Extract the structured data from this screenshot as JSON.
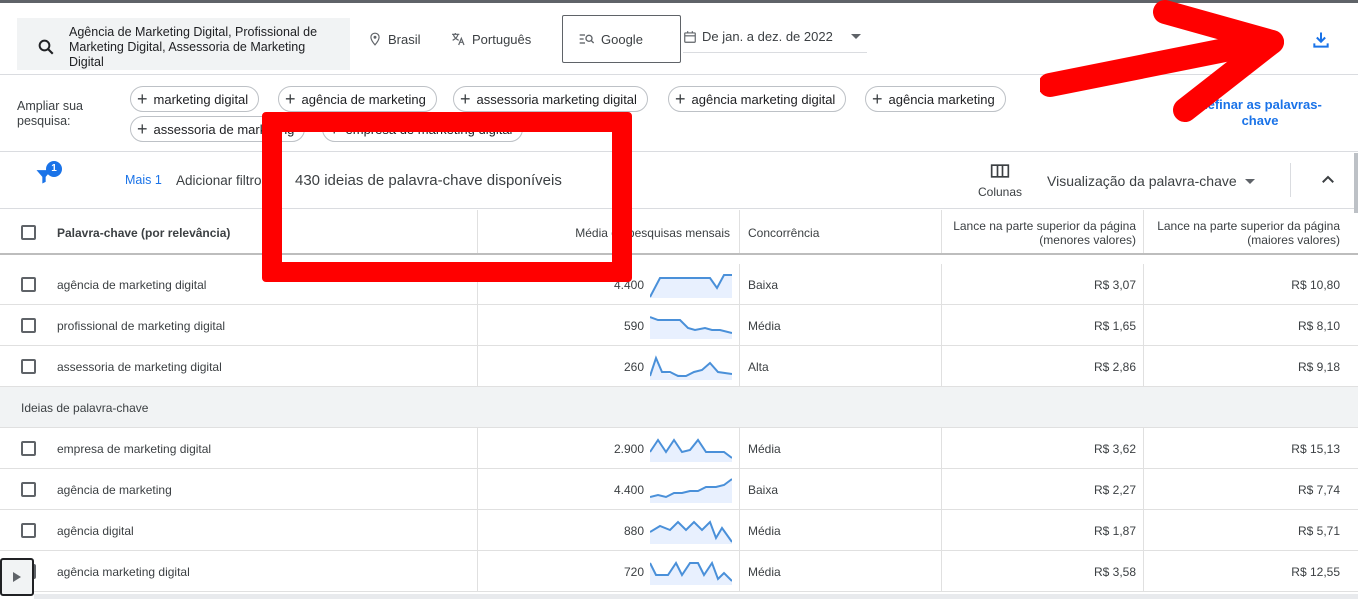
{
  "header": {
    "search_text": "Agência de Marketing Digital, Profissional de Marketing Digital, Assessoria de Marketing Digital",
    "location": "Brasil",
    "language": "Português",
    "network": "Google",
    "date_range": "De jan. a dez. de 2022"
  },
  "expand": {
    "label": "Ampliar sua pesquisa:",
    "chips": [
      "marketing digital",
      "agência de marketing",
      "assessoria marketing digital",
      "agência marketing digital",
      "agência marketing",
      "assessoria de marketing",
      "empresa de marketing digital"
    ],
    "refine_label": "Refinar as palavras-chave"
  },
  "toolbar": {
    "filter_badge": "1",
    "more_label": "Mais 1",
    "add_filter_label": "Adicionar filtro",
    "ideas_count": "430 ideias de palavra-chave disponíveis",
    "columns_label": "Colunas",
    "view_label": "Visualização da palavra-chave"
  },
  "table": {
    "headers": {
      "keyword": "Palavra-chave (por relevância)",
      "avg_searches": "Média de pesquisas mensais",
      "competition": "Concorrência",
      "bid_low": "Lance na parte superior da página (menores valores)",
      "bid_high": "Lance na parte superior da página (maiores valores)"
    },
    "provided_rows": [
      {
        "keyword": "agência de marketing digital",
        "searches": "4.400",
        "competition": "Baixa",
        "bid_low": "R$ 3,07",
        "bid_high": "R$ 10,80"
      },
      {
        "keyword": "profissional de marketing digital",
        "searches": "590",
        "competition": "Média",
        "bid_low": "R$ 1,65",
        "bid_high": "R$ 8,10"
      },
      {
        "keyword": "assessoria de marketing digital",
        "searches": "260",
        "competition": "Alta",
        "bid_low": "R$ 2,86",
        "bid_high": "R$ 9,18"
      }
    ],
    "section_label": "Ideias de palavra-chave",
    "idea_rows": [
      {
        "keyword": "empresa de marketing digital",
        "searches": "2.900",
        "competition": "Média",
        "bid_low": "R$ 3,62",
        "bid_high": "R$ 15,13"
      },
      {
        "keyword": "agência de marketing",
        "searches": "4.400",
        "competition": "Baixa",
        "bid_low": "R$ 2,27",
        "bid_high": "R$ 7,74"
      },
      {
        "keyword": "agência digital",
        "searches": "880",
        "competition": "Média",
        "bid_low": "R$ 1,87",
        "bid_high": "R$ 5,71"
      },
      {
        "keyword": "agência marketing digital",
        "searches": "720",
        "competition": "Média",
        "bid_low": "R$ 3,58",
        "bid_high": "R$ 12,55"
      }
    ]
  },
  "colors": {
    "accent": "#1a73e8",
    "annotation_red": "#ff0000",
    "sparkline": "#4a90d9"
  }
}
